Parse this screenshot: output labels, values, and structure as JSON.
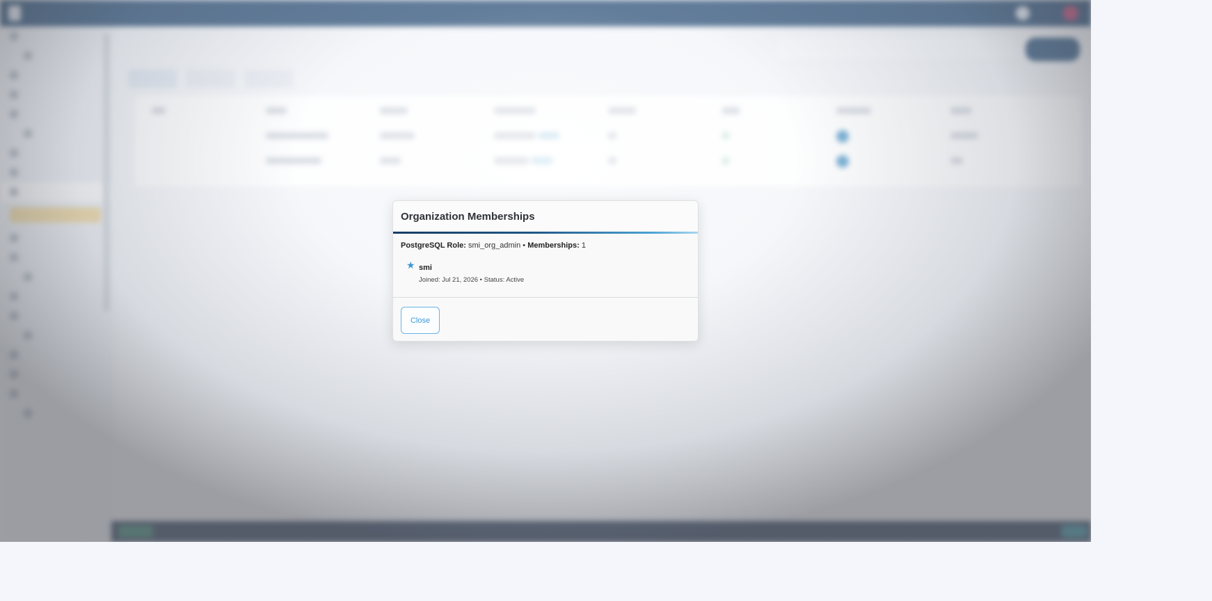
{
  "background_app": {
    "accent": "#113a66"
  },
  "modal": {
    "title": "Organization Memberships",
    "role_label": "PostgreSQL Role:",
    "role_value": "smi_org_admin",
    "separator": "•",
    "memberships_label": "Memberships:",
    "memberships_count": "1",
    "members": [
      {
        "icon": "star-icon",
        "name": "smi",
        "joined": "Joined: Jul 21, 2026 • Status: Active"
      }
    ],
    "close_label": "Close"
  },
  "colors": {
    "header_rule_start": "#163c63",
    "header_rule_end": "#4aa2d6",
    "button_accent": "#3a9ad6",
    "star": "#3c97cf"
  }
}
